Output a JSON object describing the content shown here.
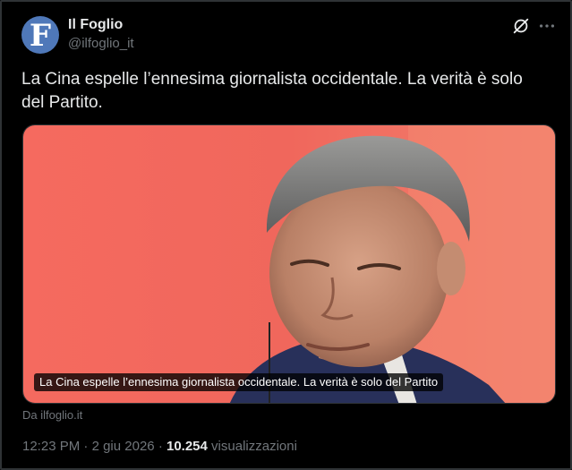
{
  "author": {
    "avatar_letter": "F",
    "avatar_color": "#4f78b9",
    "display_name": "Il Foglio",
    "handle": "@ilfoglio_it"
  },
  "header_icons": [
    "grok-icon",
    "more-icon"
  ],
  "tweet": {
    "text": "La Cina espelle l’ennesima giornalista occidentale. La verità è solo del Partito."
  },
  "media": {
    "caption": "La Cina espelle l’ennesima giornalista occidentale. La verità è solo del Partito",
    "source": "Da ilfoglio.it"
  },
  "meta": {
    "time": "12:23 PM",
    "separator": "·",
    "date": "2 giu 2026",
    "views_count": "10.254",
    "views_label": "visualizzazioni"
  },
  "colors": {
    "background": "#000000",
    "text_primary": "#e7e9ea",
    "text_secondary": "#71767b",
    "photo_background": "#f26d63"
  }
}
